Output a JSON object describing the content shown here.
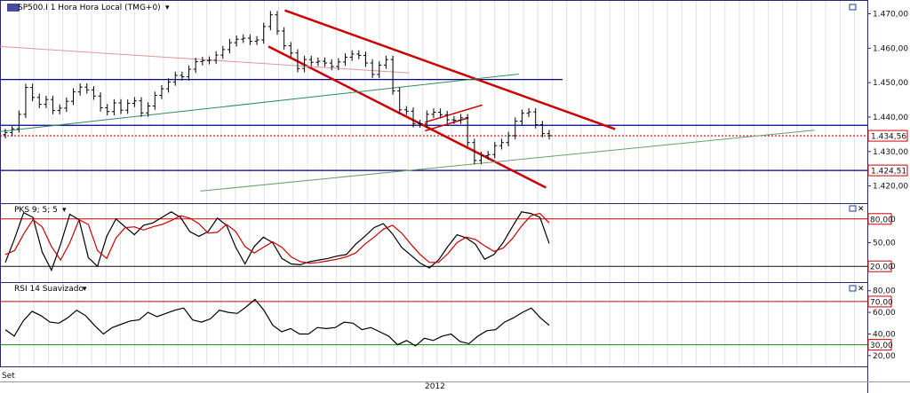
{
  "chart_data": [
    {
      "type": "candlestick",
      "title": "SP500.I 1 Hora Hora Local (TMG+0)",
      "y_ticks": [
        "1.470,00",
        "1.460,00",
        "1.450,00",
        "1.440,00",
        "1.430,00",
        "1.420,00"
      ],
      "tick_values": [
        1470,
        1460,
        1450,
        1440,
        1430,
        1420
      ],
      "ylim": [
        1415,
        1474
      ],
      "price_labels": [
        {
          "text": "1.434,56",
          "value": 1434.56,
          "color": "#cc0000"
        },
        {
          "text": "1.424,51",
          "value": 1424.51,
          "color": "#cc0000"
        }
      ],
      "horizontal_lines": [
        {
          "value": 1450.9,
          "color": "#00008b",
          "style": "solid"
        },
        {
          "value": 1437.6,
          "color": "#00008b",
          "style": "solid"
        },
        {
          "value": 1424.51,
          "color": "#00008b",
          "style": "solid"
        },
        {
          "value": 1434.56,
          "color": "#cc0000",
          "style": "dotted"
        }
      ],
      "trendlines": [
        {
          "name": "upper-channel",
          "from": [
            0.313,
            1471.0
          ],
          "to": [
            0.676,
            1436.5
          ],
          "color": "#cc0000",
          "width": 2.5
        },
        {
          "name": "lower-channel",
          "from": [
            0.295,
            1460.5
          ],
          "to": [
            0.6,
            1419.5
          ],
          "color": "#cc0000",
          "width": 2.5
        },
        {
          "name": "green-support",
          "from": [
            0.0,
            1435.8
          ],
          "to": [
            0.57,
            1452.5
          ],
          "color": "#2e8b57",
          "width": 1
        },
        {
          "name": "faint-red",
          "from": [
            0.0,
            1460.5
          ],
          "to": [
            0.45,
            1452.8
          ],
          "color": "#d99",
          "width": 1
        },
        {
          "name": "gray-long",
          "from": [
            0.22,
            1418.5
          ],
          "to": [
            0.895,
            1436.2
          ],
          "color": "#6a9e6a",
          "width": 1
        },
        {
          "name": "small-up-1",
          "from": [
            0.467,
            1438.5
          ],
          "to": [
            0.53,
            1443.5
          ],
          "color": "#cc0000",
          "width": 1.5
        },
        {
          "name": "small-up-2",
          "from": [
            0.467,
            1436.0
          ],
          "to": [
            0.515,
            1439.8
          ],
          "color": "#cc0000",
          "width": 1.5
        }
      ],
      "closes": [
        1435.5,
        1436.6,
        1440.8,
        1448.6,
        1445.7,
        1443.7,
        1445.1,
        1441.9,
        1442.6,
        1444.6,
        1447.3,
        1448.7,
        1447.9,
        1446.1,
        1442.7,
        1441.6,
        1444.1,
        1442.0,
        1444.0,
        1444.7,
        1441.2,
        1443.2,
        1446.3,
        1448.2,
        1450.2,
        1452.1,
        1451.7,
        1453.9,
        1456.1,
        1456.4,
        1456.5,
        1458.0,
        1459.6,
        1461.6,
        1462.6,
        1462.9,
        1462.0,
        1462.4,
        1466.3,
        1469.7,
        1465.0,
        1460.7,
        1458.6,
        1454.1,
        1456.7,
        1455.9,
        1456.2,
        1455.7,
        1454.7,
        1456.0,
        1457.4,
        1458.3,
        1457.9,
        1455.7,
        1452.4,
        1455.1,
        1456.7,
        1447.6,
        1442.1,
        1441.7,
        1438.1,
        1438.0,
        1440.8,
        1441.4,
        1440.7,
        1439.2,
        1439.1,
        1439.8,
        1432.6,
        1427.4,
        1428.8,
        1429.1,
        1431.7,
        1432.6,
        1434.6,
        1438.8,
        1441.1,
        1441.5,
        1437.8,
        1435.2,
        1434.6
      ],
      "x_label": "2012",
      "x_start_label": "Set"
    },
    {
      "type": "line",
      "title": "PKS 9; 5; 5",
      "ylim": [
        0,
        100
      ],
      "y_ticks": [
        "80,00",
        "50,00",
        "20,00"
      ],
      "tick_values": [
        80,
        50,
        20
      ],
      "level_labels": [
        "80,00",
        "20,00"
      ],
      "levels": [
        {
          "value": 80,
          "color": "#cc0000"
        },
        {
          "value": 20,
          "color": "#111111"
        }
      ],
      "series": [
        {
          "color": "#000000",
          "values": [
            25,
            55,
            88,
            82,
            38,
            15,
            48,
            86,
            79,
            31,
            20,
            58,
            80,
            70,
            60,
            72,
            75,
            82,
            89,
            82,
            64,
            58,
            64,
            81,
            72,
            44,
            23,
            45,
            57,
            50,
            30,
            23,
            22,
            26,
            28,
            30,
            33,
            35,
            48,
            58,
            69,
            74,
            61,
            44,
            34,
            24,
            18,
            28,
            45,
            60,
            56,
            48,
            29,
            35,
            50,
            70,
            89,
            87,
            82,
            49
          ]
        },
        {
          "color": "#cc0000",
          "values": [
            35,
            40,
            61,
            79,
            70,
            45,
            28,
            50,
            79,
            73,
            40,
            30,
            56,
            69,
            70,
            66,
            70,
            73,
            78,
            84,
            81,
            74,
            62,
            63,
            73,
            64,
            45,
            37,
            44,
            51,
            44,
            32,
            26,
            24,
            25,
            27,
            29,
            32,
            37,
            48,
            57,
            67,
            72,
            62,
            48,
            35,
            25,
            25,
            36,
            50,
            57,
            54,
            46,
            39,
            43,
            55,
            71,
            84,
            87,
            75
          ]
        }
      ]
    },
    {
      "type": "line",
      "title": "RSI 14 Suavizado",
      "ylim": [
        10,
        88
      ],
      "y_ticks": [
        "80,00",
        "60,00",
        "40,00",
        "20,00"
      ],
      "tick_values": [
        80,
        60,
        40,
        20
      ],
      "level_labels": [
        "70,00",
        "30,00"
      ],
      "levels": [
        {
          "value": 70,
          "color": "#cc0000"
        },
        {
          "value": 30,
          "color": "#118811"
        }
      ],
      "series": [
        {
          "color": "#000000",
          "values": [
            44,
            38,
            52,
            61,
            57,
            51,
            50,
            55,
            62,
            57,
            48,
            40,
            46,
            49,
            52,
            53,
            60,
            56,
            59,
            62,
            64,
            53,
            51,
            54,
            62,
            60,
            59,
            65,
            72,
            62,
            48,
            42,
            45,
            40,
            40,
            46,
            45,
            46,
            51,
            50,
            44,
            46,
            42,
            38,
            30,
            34,
            29,
            36,
            34,
            38,
            40,
            33,
            31,
            38,
            43,
            44,
            51,
            55,
            60,
            64,
            55,
            48
          ]
        }
      ]
    }
  ]
}
